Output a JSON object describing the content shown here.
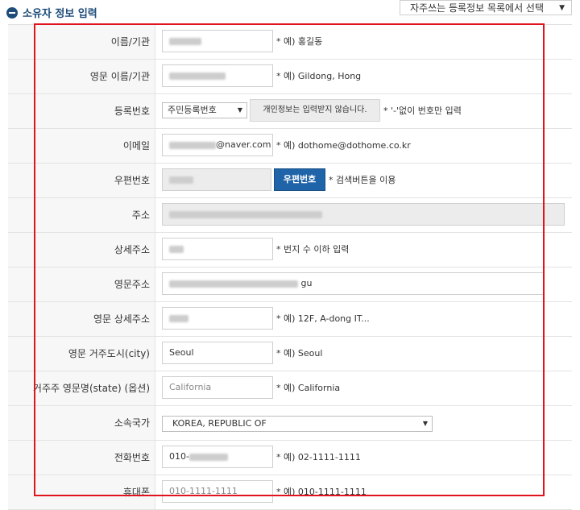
{
  "header": {
    "title": "소유자 정보 입력",
    "preset_select": "자주쓰는 등록정보 목록에서 선택"
  },
  "rows": {
    "name": {
      "label": "이름/기관",
      "hint": "* 예) 홍길동"
    },
    "eng_name": {
      "label": "영문 이름/기관",
      "hint": "* 예) Gildong, Hong"
    },
    "reg_no": {
      "label": "등록번호",
      "select": "주민등록번호",
      "note": "개인정보는 입력받지 않습니다.",
      "hint": "* '-'없이 번호만 입력"
    },
    "email": {
      "label": "이메일",
      "value_suffix": "@naver.com",
      "hint": "* 예) dothome@dothome.co.kr"
    },
    "zip": {
      "label": "우편번호",
      "button": "우편번호",
      "hint": "* 검색버튼을 이용"
    },
    "address": {
      "label": "주소"
    },
    "detail_address": {
      "label": "상세주소",
      "hint": "* 번지 수 이하 입력"
    },
    "eng_address": {
      "label": "영문주소",
      "value_suffix": "gu"
    },
    "eng_detail_address": {
      "label": "영문 상세주소",
      "hint": "* 예) 12F, A-dong IT..."
    },
    "eng_city": {
      "label": "영문 거주도시(city)",
      "value": "Seoul",
      "hint": "* 예) Seoul"
    },
    "state": {
      "label": "거주주 영문명(state) (옵션)",
      "placeholder": "California",
      "hint": "* 예) California"
    },
    "country": {
      "label": "소속국가",
      "select": "KOREA, REPUBLIC OF"
    },
    "phone": {
      "label": "전화번호",
      "value_prefix": "010-",
      "hint": "* 예) 02-1111-1111"
    },
    "mobile": {
      "label": "휴대폰",
      "placeholder": "010-1111-1111",
      "hint": "* 예) 010-1111-1111"
    }
  },
  "colors": {
    "accent": "#1f4d7a",
    "button": "#1f63a8",
    "highlight": "#e0141e"
  }
}
